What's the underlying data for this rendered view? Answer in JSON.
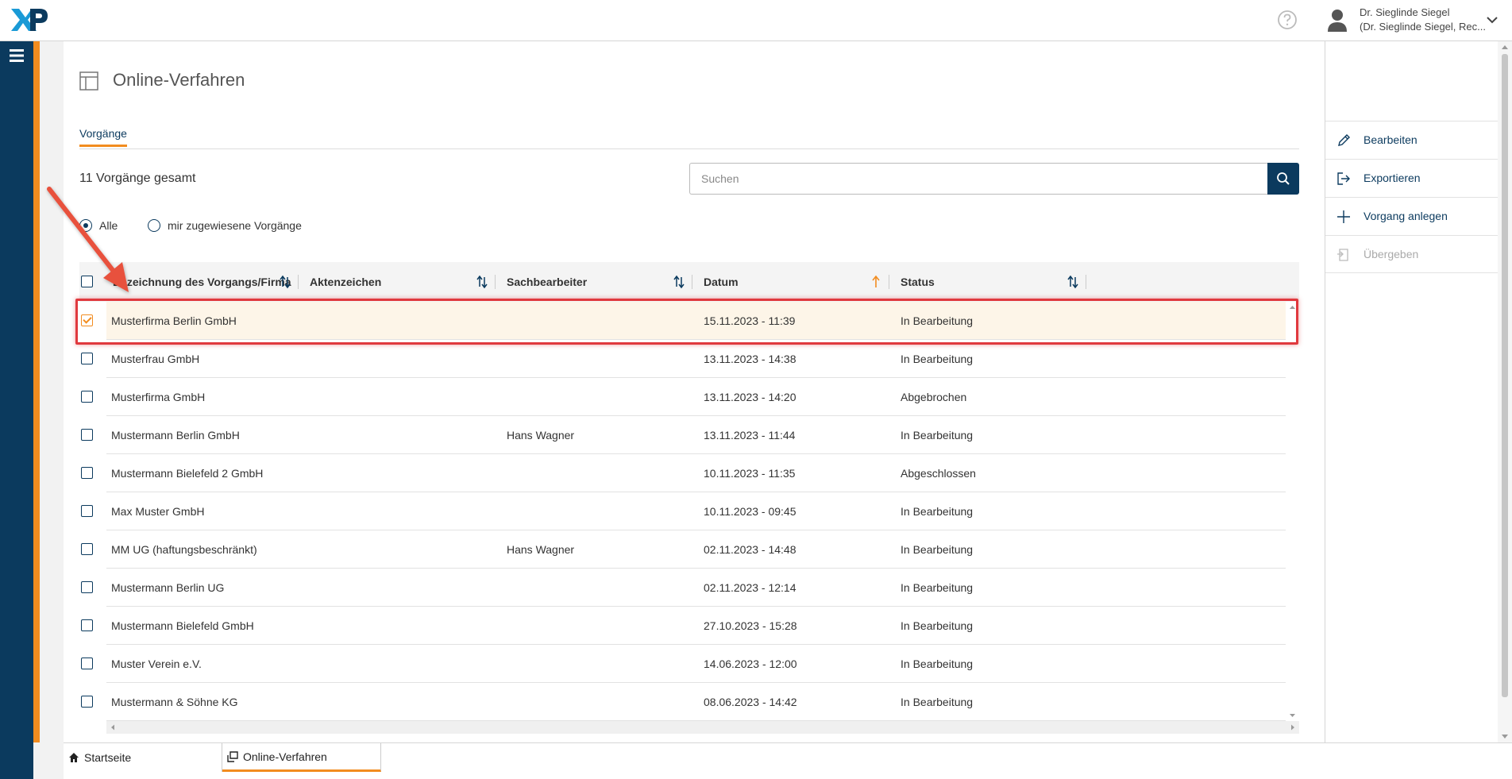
{
  "header": {
    "logo_text": "XP",
    "user_name": "Dr. Sieglinde Siegel",
    "user_org": "(Dr. Sieglinde Siegel, Rec..."
  },
  "icons": {
    "menu": "menu-icon",
    "help": "help-icon",
    "avatar": "user-icon",
    "search": "search-icon"
  },
  "colors": {
    "brand_dark": "#0b3a5e",
    "accent": "#f28c1f",
    "annotation": "#e0393e"
  },
  "page": {
    "title": "Online-Verfahren",
    "tab": "Vorgänge",
    "total": "11 Vorgänge gesamt",
    "search_placeholder": "Suchen"
  },
  "filter": {
    "all": "Alle",
    "assigned": "mir zugewiesene Vorgänge",
    "selected": "Alle"
  },
  "table": {
    "columns": [
      "Bezeichnung des Vorgangs/Firma",
      "Aktenzeichen",
      "Sachbearbeiter",
      "Datum",
      "Status"
    ],
    "rows": [
      {
        "name": "Musterfirma Berlin GmbH",
        "az": "",
        "sb": "",
        "datum": "15.11.2023 - 11:39",
        "status": "In Bearbeitung",
        "checked": true
      },
      {
        "name": "Musterfrau GmbH",
        "az": "",
        "sb": "",
        "datum": "13.11.2023 - 14:38",
        "status": "In Bearbeitung",
        "checked": false
      },
      {
        "name": "Musterfirma GmbH",
        "az": "",
        "sb": "",
        "datum": "13.11.2023 - 14:20",
        "status": "Abgebrochen",
        "checked": false
      },
      {
        "name": "Mustermann Berlin GmbH",
        "az": "",
        "sb": "Hans Wagner",
        "datum": "13.11.2023 - 11:44",
        "status": "In Bearbeitung",
        "checked": false
      },
      {
        "name": "Mustermann Bielefeld 2 GmbH",
        "az": "",
        "sb": "",
        "datum": "10.11.2023 - 11:35",
        "status": "Abgeschlossen",
        "checked": false
      },
      {
        "name": "Max Muster GmbH",
        "az": "",
        "sb": "",
        "datum": "10.11.2023 - 09:45",
        "status": "In Bearbeitung",
        "checked": false
      },
      {
        "name": "MM UG (haftungsbeschränkt)",
        "az": "",
        "sb": "Hans Wagner",
        "datum": "02.11.2023 - 14:48",
        "status": "In Bearbeitung",
        "checked": false
      },
      {
        "name": "Mustermann Berlin UG",
        "az": "",
        "sb": "",
        "datum": "02.11.2023 - 12:14",
        "status": "In Bearbeitung",
        "checked": false
      },
      {
        "name": "Mustermann Bielefeld GmbH",
        "az": "",
        "sb": "",
        "datum": "27.10.2023 - 15:28",
        "status": "In Bearbeitung",
        "checked": false
      },
      {
        "name": "Muster Verein e.V.",
        "az": "",
        "sb": "",
        "datum": "14.06.2023 - 12:00",
        "status": "In Bearbeitung",
        "checked": false
      },
      {
        "name": "Mustermann & Söhne KG",
        "az": "",
        "sb": "",
        "datum": "08.06.2023 - 14:42",
        "status": "In Bearbeitung",
        "checked": false
      }
    ]
  },
  "actions": [
    {
      "label": "Bearbeiten",
      "icon": "pencil-icon",
      "enabled": true
    },
    {
      "label": "Exportieren",
      "icon": "export-icon",
      "enabled": true
    },
    {
      "label": "Vorgang anlegen",
      "icon": "plus-icon",
      "enabled": true
    },
    {
      "label": "Übergeben",
      "icon": "handover-icon",
      "enabled": false
    }
  ],
  "bottom_tabs": [
    {
      "label": "Startseite",
      "icon": "home-icon",
      "active": false
    },
    {
      "label": "Online-Verfahren",
      "icon": "procedure-icon",
      "active": true
    }
  ]
}
